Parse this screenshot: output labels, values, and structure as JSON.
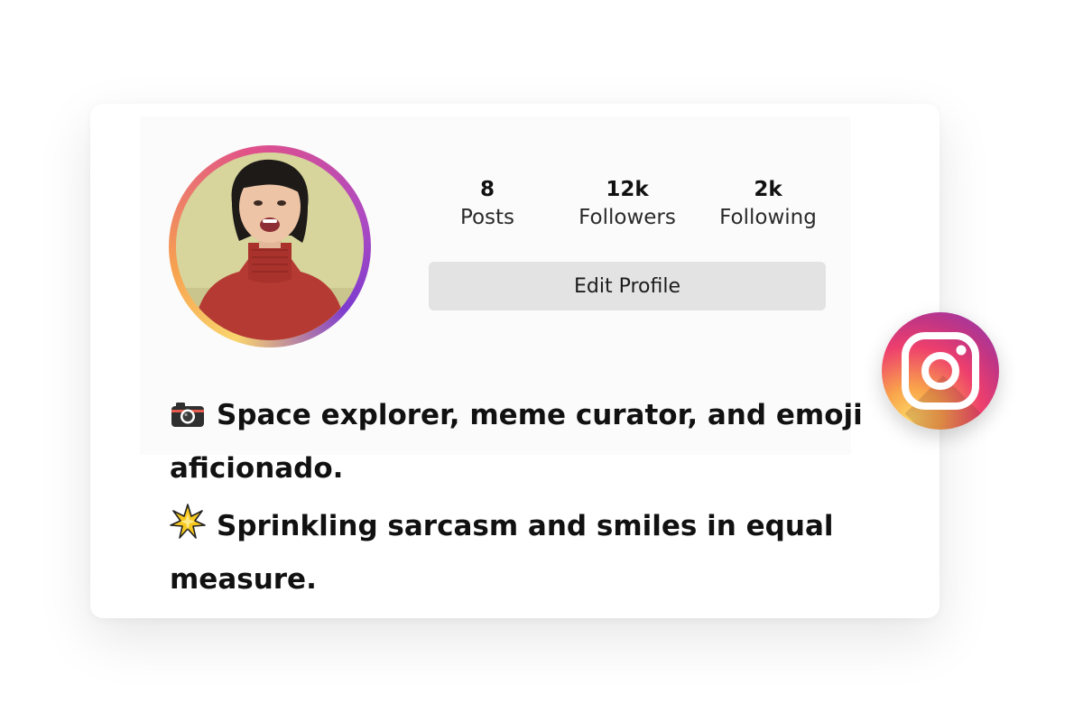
{
  "profile": {
    "avatar_alt": "profile photo",
    "stats": [
      {
        "value": "8",
        "label": "Posts"
      },
      {
        "value": "12k",
        "label": "Followers"
      },
      {
        "value": "2k",
        "label": "Following"
      }
    ],
    "edit_profile_label": "Edit Profile",
    "bio": [
      {
        "emoji": "camera-icon",
        "text": "Space explorer, meme curator, and emoji aficionado."
      },
      {
        "emoji": "sparkle-icon",
        "text": "Sprinkling sarcasm and smiles in equal measure."
      }
    ]
  },
  "badge": {
    "icon": "instagram-icon"
  },
  "colors": {
    "card_bg": "#ffffff",
    "button_bg": "#e3e3e3",
    "gradient_start": "#fdd663",
    "gradient_mid": "#ee3f6d",
    "gradient_end": "#8a3ab9"
  }
}
